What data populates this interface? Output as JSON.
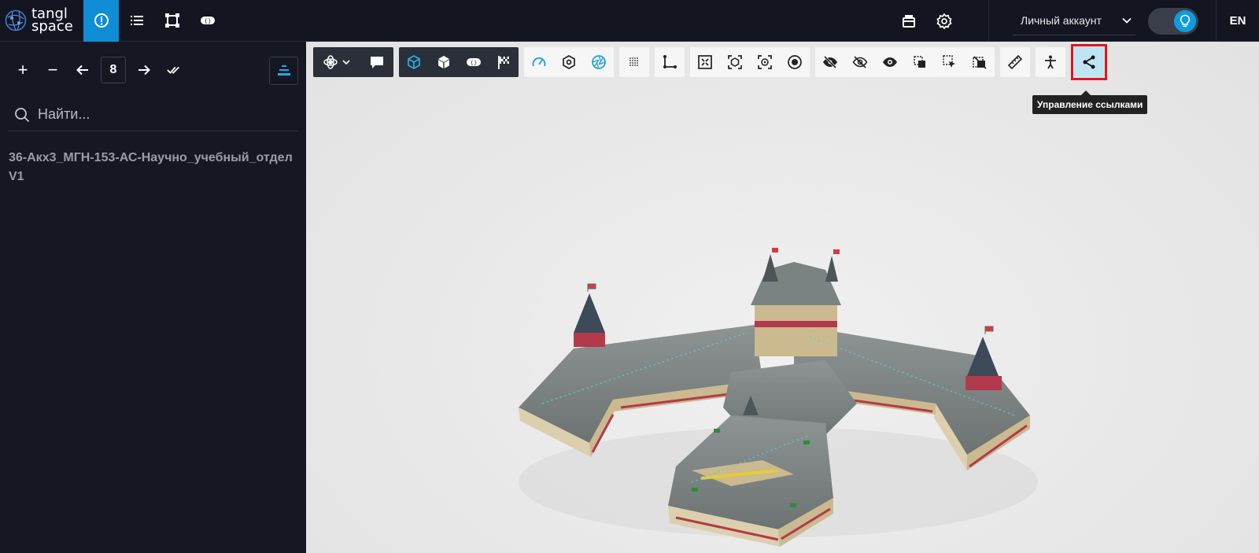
{
  "app": {
    "logo_line1": "tangl",
    "logo_line2": "space"
  },
  "topbar": {
    "nav_icons": [
      "info-icon",
      "list-icon",
      "crop-icon",
      "tag-icon"
    ],
    "right_icons": [
      "print-icon",
      "gear-icon"
    ],
    "account_label": "Личный аккаунт",
    "language": "EN",
    "accent": "#0f8ed6"
  },
  "sidebar": {
    "plus_label": "+",
    "minus_label": "−",
    "level_value": "8",
    "search_placeholder": "Найти...",
    "model_name": "36-Акх3_МГН-153-АС-Научно_учебный_отдел V1"
  },
  "viewport": {
    "tooltip": "Управление ссылками",
    "highlight_color": "#e0161c"
  }
}
